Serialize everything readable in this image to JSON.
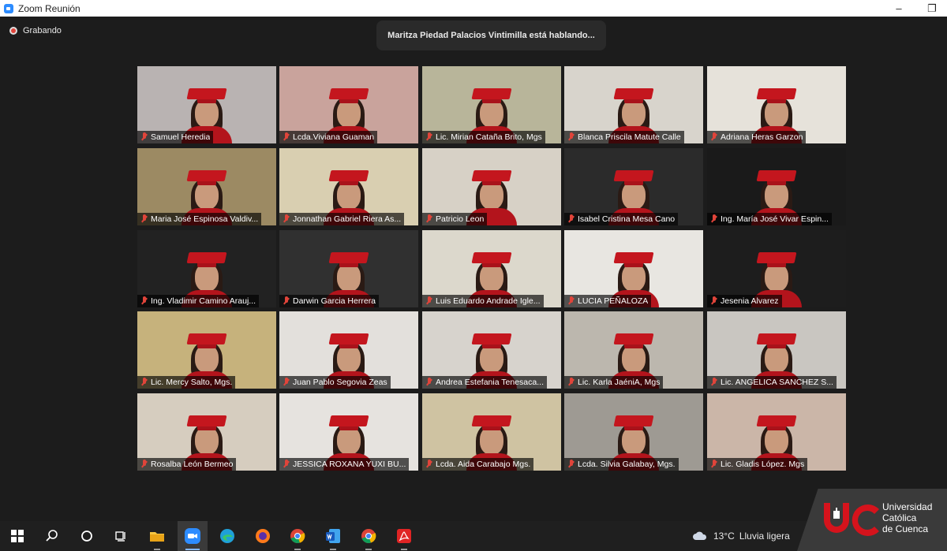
{
  "window": {
    "title": "Zoom Reunión"
  },
  "recording": {
    "label": "Grabando"
  },
  "speaker_banner": "Maritza Piedad Palacios Vintimilla está hablando...",
  "colors": {
    "accent": "#c4161e",
    "stage": "#1c1c1c",
    "mic_muted": "#e0443a"
  },
  "participants": [
    {
      "name": "Samuel Heredia",
      "bg": "#b9b3b2"
    },
    {
      "name": "Lcda.Viviana Guaman",
      "bg": "#c9a39c"
    },
    {
      "name": "Lic. Mirian Cataña Brito, Mgs",
      "bg": "#b8b59a"
    },
    {
      "name": "Blanca Priscila Matute Calle",
      "bg": "#d8d4cc"
    },
    {
      "name": "Adriana Heras Garzon",
      "bg": "#e6e2da"
    },
    {
      "name": "Maria José Espinosa Valdiv...",
      "bg": "#9c8a63"
    },
    {
      "name": "Jonnathan Gabriel Riera As...",
      "bg": "#d9cfb1"
    },
    {
      "name": "Patricio Leon",
      "bg": "#d7d1c6"
    },
    {
      "name": "Isabel Cristina Mesa Cano",
      "bg": "#2b2b2b"
    },
    {
      "name": "Ing. María José Vivar Espin...",
      "bg": "#1a1a1a"
    },
    {
      "name": "Ing. Vladimir Camino Arauj...",
      "bg": "#222222"
    },
    {
      "name": "Darwin Garcia Herrera",
      "bg": "#303030"
    },
    {
      "name": "Luis Eduardo Andrade Igle...",
      "bg": "#dcd8cc"
    },
    {
      "name": "LUCIA PEÑALOZA",
      "bg": "#e8e6e1"
    },
    {
      "name": "Jesenia Alvarez",
      "bg": "#1d1d1d"
    },
    {
      "name": "Lic. Mercy Salto, Mgs.",
      "bg": "#c6b27c"
    },
    {
      "name": "Juan Pablo Segovia Zeas",
      "bg": "#e3e0dc"
    },
    {
      "name": "Andrea Estefania Tenesaca...",
      "bg": "#d7d3cd"
    },
    {
      "name": "Lic. Karla JaéniA, Mgs",
      "bg": "#bcb7ae"
    },
    {
      "name": "Lic. ANGELICA SANCHEZ S...",
      "bg": "#c9c6c1"
    },
    {
      "name": "Rosalba León Bermeo",
      "bg": "#d6cdbf"
    },
    {
      "name": "JESSICA ROXANA YUXI BU...",
      "bg": "#e6e3df"
    },
    {
      "name": "Lcda. Aida Carabajo Mgs.",
      "bg": "#cfc3a2"
    },
    {
      "name": "Lcda. Silvia Galabay, Mgs.",
      "bg": "#9e9a93"
    },
    {
      "name": "Lic. Gladis López. Mgs",
      "bg": "#cbb6a8"
    }
  ],
  "taskbar": {
    "items": [
      "windows-start-icon",
      "search-icon",
      "cortana-icon",
      "task-view-icon",
      "file-explorer-icon",
      "zoom-icon",
      "edge-icon",
      "firefox-icon",
      "chrome-icon",
      "word-icon",
      "chrome-icon",
      "acrobat-icon"
    ],
    "weather": {
      "temp": "13°C",
      "desc": "Lluvia ligera"
    }
  },
  "logo": {
    "line1": "Universidad",
    "line2": "Católica",
    "line3": "de Cuenca"
  }
}
